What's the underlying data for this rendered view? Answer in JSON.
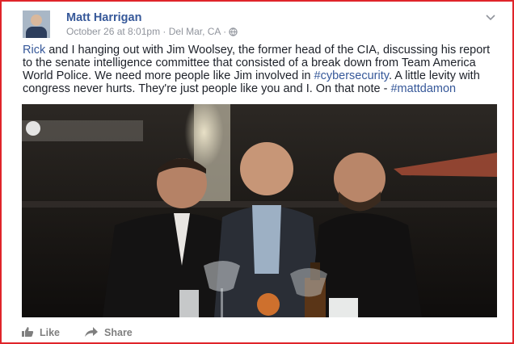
{
  "post": {
    "author": "Matt Harrigan",
    "meta": "October 26 at 8:01pm · Del Mar, CA · ",
    "text_parts": {
      "p1": "Rick",
      "p2": " and I hanging out with Jim Woolsey, the former head of the CIA, discussing his report to the senate intelligence committee that consisted of a break down from Team America World Police. We need more people like Jim involved in ",
      "p3": "#cybersecurity",
      "p4": ". A little levity with congress never hurts. They're just people like you and I. On that note - ",
      "p5": "#mattdamon"
    }
  },
  "actions": {
    "like": "Like",
    "share": "Share"
  },
  "icons": {
    "privacy": "globe-icon",
    "menu": "chevron-down-icon",
    "like": "thumbs-up-icon",
    "share": "share-arrow-icon"
  },
  "colors": {
    "link": "#365899",
    "meta": "#90949c",
    "frame": "#e0242a"
  }
}
